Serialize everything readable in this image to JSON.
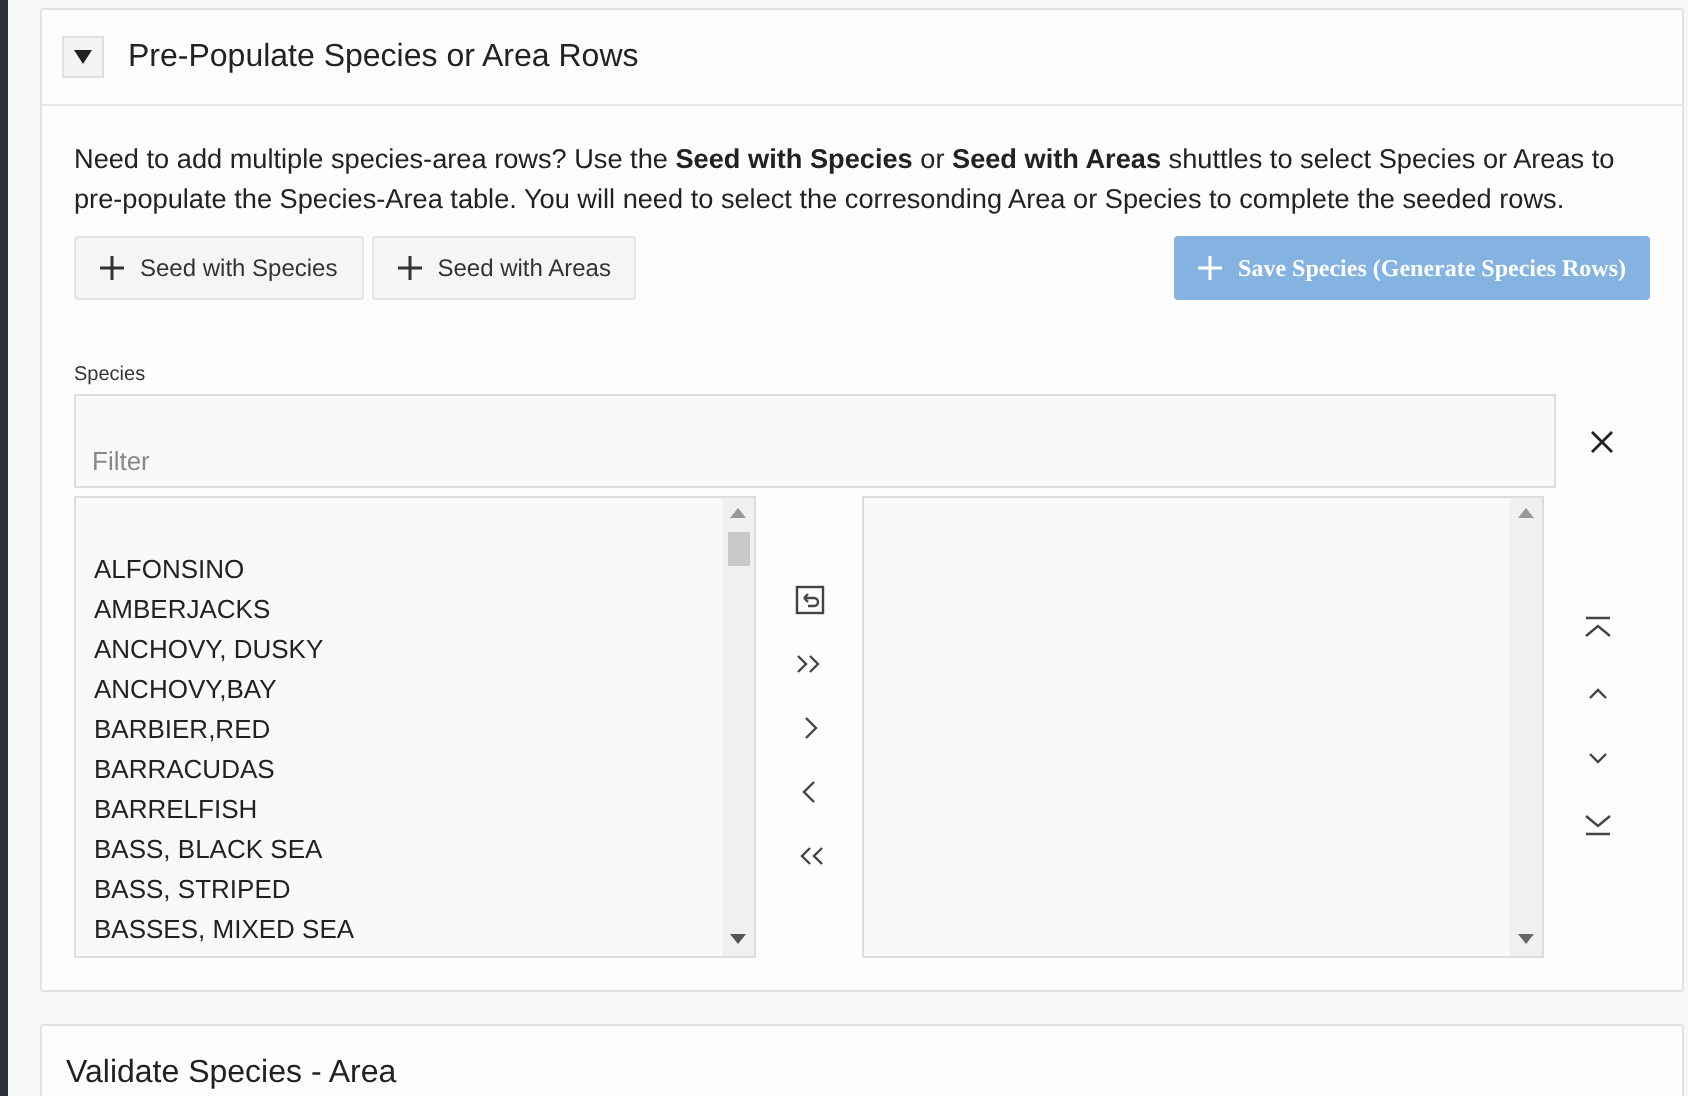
{
  "region": {
    "title": "Pre-Populate Species or Area Rows",
    "expanded": true
  },
  "description": "Need to add multiple species-area rows? Use the **Seed with Species** or **Seed with Areas** shuttles to select Species or Areas to pre-populate the Species-Area table. You will need to select the corresonding Area or Species to complete the seeded rows.",
  "seed_buttons": [
    {
      "label": "Seed with Species"
    },
    {
      "label": "Seed with Areas"
    }
  ],
  "save_button": {
    "label": "Save Species (Generate Species Rows)",
    "disabled": true
  },
  "shuttle": {
    "label": "Species",
    "filter": {
      "placeholder": "Filter"
    },
    "available": [
      "ALFONSINO",
      "AMBERJACKS",
      "ANCHOVY, DUSKY",
      "ANCHOVY,BAY",
      "BARBIER,RED",
      "BARRACUDAS",
      "BARRELFISH",
      "BASS, BLACK SEA",
      "BASS, STRIPED",
      "BASSES, MIXED SEA"
    ],
    "move_controls": [
      {
        "kind": "reset"
      },
      {
        "kind": "move-all"
      },
      {
        "kind": "move"
      },
      {
        "kind": "remove"
      },
      {
        "kind": "remove-all"
      }
    ],
    "order_controls": [
      {
        "kind": "top"
      },
      {
        "kind": "up"
      },
      {
        "kind": "down"
      },
      {
        "kind": "bottom"
      }
    ]
  },
  "next_region": {
    "title": "Validate Species - Area"
  }
}
